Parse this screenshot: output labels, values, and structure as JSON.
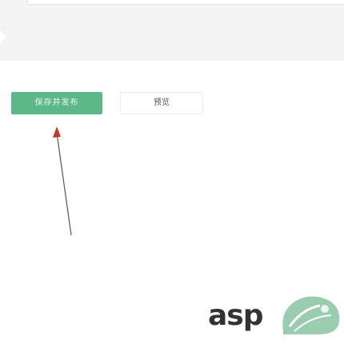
{
  "toolbar": {
    "save_publish_label": "保存并发布",
    "preview_label": "预览"
  },
  "watermark": {
    "text": "asp"
  },
  "colors": {
    "primary_button": "#5cb888",
    "annotation_arrow": "#c0392b",
    "panel_background": "#f4f4f4"
  }
}
